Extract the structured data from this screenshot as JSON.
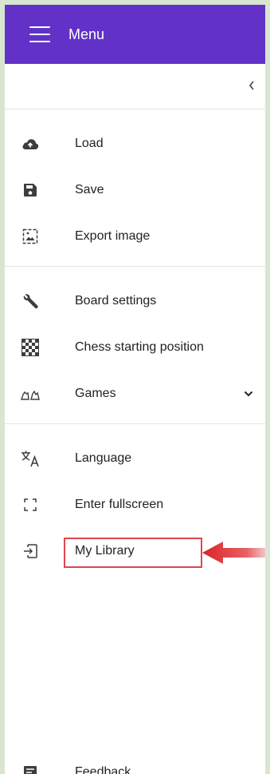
{
  "header": {
    "title": "Menu"
  },
  "groups": [
    {
      "items": [
        {
          "label": "Load",
          "icon": "cloud-upload-icon"
        },
        {
          "label": "Save",
          "icon": "save-icon"
        },
        {
          "label": "Export image",
          "icon": "export-image-icon"
        }
      ]
    },
    {
      "items": [
        {
          "label": "Board settings",
          "icon": "wrench-icon"
        },
        {
          "label": "Chess starting position",
          "icon": "checkerboard-icon"
        },
        {
          "label": "Games",
          "icon": "chess-pieces-icon",
          "expandable": true
        }
      ]
    },
    {
      "items": [
        {
          "label": "Language",
          "icon": "translate-icon"
        },
        {
          "label": "Enter fullscreen",
          "icon": "fullscreen-icon"
        },
        {
          "label": "My Library",
          "icon": "login-icon",
          "highlighted": true
        }
      ]
    }
  ],
  "footer": {
    "label": "Feedback",
    "icon": "feedback-icon"
  },
  "colors": {
    "header_bg": "#6232c8",
    "page_bg": "#d8e6d0",
    "highlight": "#e0464b"
  }
}
